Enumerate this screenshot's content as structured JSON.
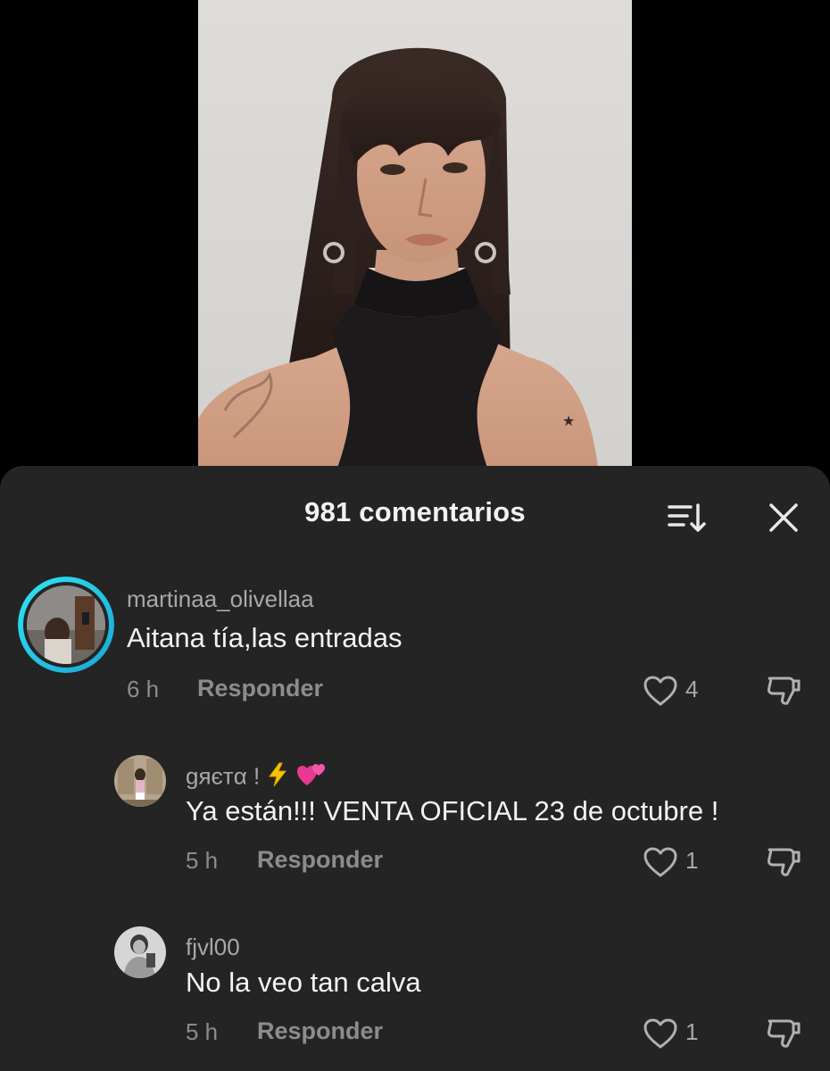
{
  "header": {
    "comment_count_label": "981 comentarios"
  },
  "icons": {
    "sort": "sort-icon",
    "close": "close-icon",
    "like": "heart-outline-icon",
    "dislike": "thumbs-down-icon"
  },
  "colors": {
    "sheet_background": "#242424",
    "story_ring_start": "#2fe3f2",
    "story_ring_end": "#1aa8d6",
    "secondary_text": "#8c8c8c"
  },
  "comments": [
    {
      "username": "martinaa_olivellaa",
      "text": "Aitana tía,las entradas",
      "time": "6 h",
      "reply_label": "Responder",
      "likes": "4",
      "has_story_ring": true
    },
    {
      "username": "gяєтα !",
      "username_emojis": [
        "lightning-emoji",
        "two-hearts-emoji"
      ],
      "text": "Ya están!!! VENTA OFICIAL 23 de octubre !",
      "time": "5 h",
      "reply_label": "Responder",
      "likes": "1",
      "is_reply": true
    },
    {
      "username": "fjvl00",
      "text": "No la veo tan calva",
      "time": "5 h",
      "reply_label": "Responder",
      "likes": "1",
      "is_reply": true
    }
  ]
}
